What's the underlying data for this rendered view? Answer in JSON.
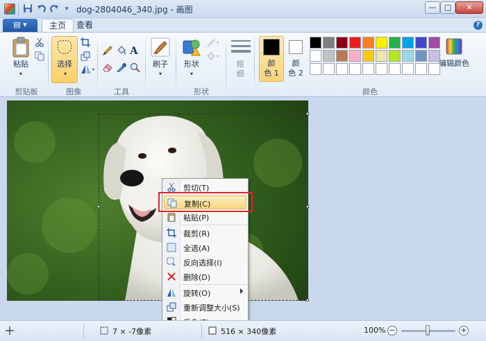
{
  "window": {
    "title": "dog-2804046_340.jpg - 画图",
    "minimize": "—",
    "maximize": "□",
    "close": "✕"
  },
  "quick_access": [
    "save-icon",
    "undo-icon",
    "redo-icon",
    "chevron-down-icon"
  ],
  "tabs": {
    "file": "▤ ▾",
    "home": "主页",
    "view": "查看",
    "help": "?"
  },
  "ribbon": {
    "clipboard": {
      "paste": "粘贴",
      "group": "剪贴板"
    },
    "image": {
      "select": "选择",
      "group": "图像"
    },
    "tools": {
      "group": "工具"
    },
    "brushes": {
      "label": "刷子"
    },
    "shapes": {
      "label": "形状",
      "group": "形状"
    },
    "size": {
      "label_line1": "粗",
      "label_line2": "细"
    },
    "colors": {
      "color1_line1": "颜",
      "color1_line2": "色 1",
      "color2_line1": "颜",
      "color2_line2": "色 2",
      "edit": "编辑颜色",
      "group": "颜色",
      "color1_value": "#000000",
      "color2_value": "#ffffff",
      "palette": [
        "#000000",
        "#7f7f7f",
        "#880015",
        "#ed1c24",
        "#ff7f27",
        "#fff200",
        "#22b14c",
        "#00a2e8",
        "#3f48cc",
        "#a349a4",
        "#ffffff",
        "#c3c3c3",
        "#b97a57",
        "#ffaec9",
        "#ffc90e",
        "#efe4b0",
        "#b5e61d",
        "#99d9ea",
        "#7092be",
        "#c8bfe7",
        "#ffffff",
        "#ffffff",
        "#ffffff",
        "#ffffff",
        "#ffffff",
        "#ffffff",
        "#ffffff",
        "#ffffff",
        "#ffffff",
        "#ffffff"
      ]
    }
  },
  "context_menu": {
    "items": [
      {
        "label": "剪切(T)",
        "icon": "scissors-icon"
      },
      {
        "label": "复制(C)",
        "icon": "copy-icon"
      },
      {
        "label": "粘贴(P)",
        "icon": "paste-icon"
      },
      {
        "label": "裁剪(R)",
        "icon": "crop-icon"
      },
      {
        "label": "全选(A)",
        "icon": "select-all-icon"
      },
      {
        "label": "反向选择(I)",
        "icon": "invert-selection-icon"
      },
      {
        "label": "删除(D)",
        "icon": "delete-icon"
      },
      {
        "label": "旋转(O)",
        "icon": "rotate-icon"
      },
      {
        "label": "重新调整大小(S)",
        "icon": "resize-icon"
      },
      {
        "label": "反色(E)",
        "icon": "invert-color-icon"
      }
    ],
    "highlighted": "复制(C)"
  },
  "status": {
    "selection_size": "7 × -7像素",
    "image_size": "516 × 340像素",
    "zoom": "100%",
    "zoom_out": "−",
    "zoom_in": "+"
  }
}
